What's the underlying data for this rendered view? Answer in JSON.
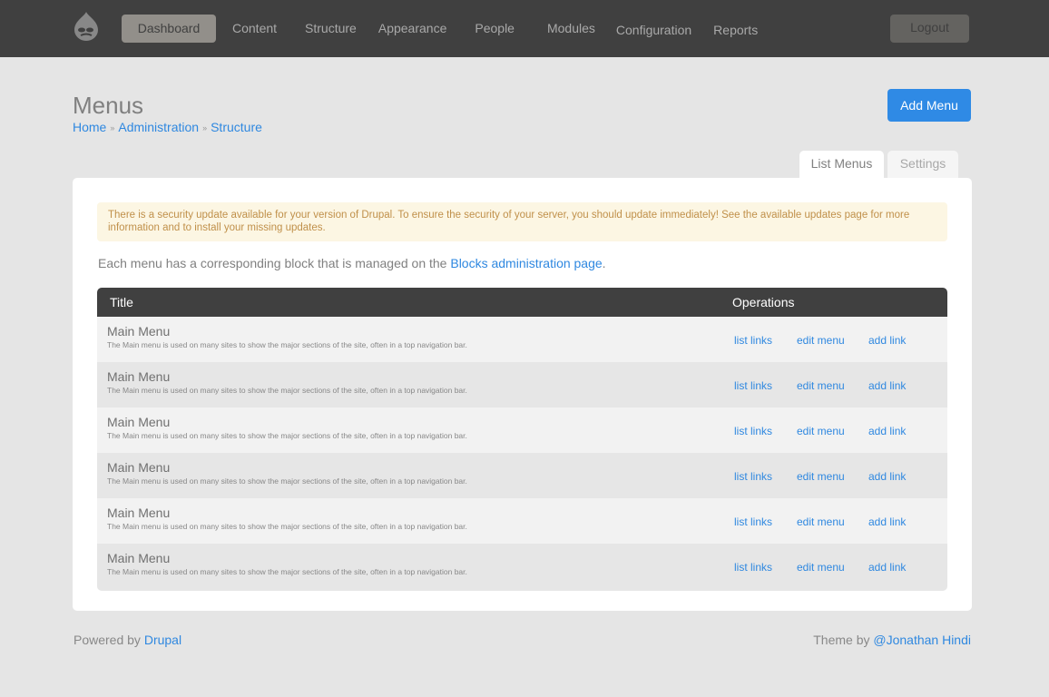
{
  "nav": {
    "items": [
      "Dashboard",
      "Content",
      "Structure",
      "Appearance",
      "People",
      "Modules",
      "Configuration",
      "Reports"
    ],
    "active": "Dashboard",
    "logout": "Logout"
  },
  "page": {
    "title": "Menus",
    "breadcrumb": [
      "Home",
      "Administration",
      "Structure"
    ],
    "add_button": "Add Menu"
  },
  "tabs": [
    "List Menus",
    "Settings"
  ],
  "alert": "There is a security update available for your version of Drupal. To ensure the security of your server, you should update immediately! See the available updates page for more information and to install your missing updates.",
  "intro": {
    "text": "Each menu has a corresponding block that is managed on the ",
    "link": "Blocks administration page",
    "end": "."
  },
  "table": {
    "headers": [
      "Title",
      "Operations"
    ],
    "rows": [
      {
        "title": "Main Menu",
        "desc": "The Main menu is used on many sites to show the major sections of the site, often in a top navigation bar.",
        "ops": [
          "list links",
          "edit menu",
          "add link"
        ]
      },
      {
        "title": "Main Menu",
        "desc": "The Main menu is used on many sites to show the major sections of the site, often in a top navigation bar.",
        "ops": [
          "list links",
          "edit menu",
          "add link"
        ]
      },
      {
        "title": "Main Menu",
        "desc": "The Main menu is used on many sites to show the major sections of the site, often in a top navigation bar.",
        "ops": [
          "list links",
          "edit menu",
          "add link"
        ]
      },
      {
        "title": "Main Menu",
        "desc": "The Main menu is used on many sites to show the major sections of the site, often in a top navigation bar.",
        "ops": [
          "list links",
          "edit menu",
          "add link"
        ]
      },
      {
        "title": "Main Menu",
        "desc": "The Main menu is used on many sites to show the major sections of the site, often in a top navigation bar.",
        "ops": [
          "list links",
          "edit menu",
          "add link"
        ]
      },
      {
        "title": "Main Menu",
        "desc": "The Main menu is used on many sites to show the major sections of the site, often in a top navigation bar.",
        "ops": [
          "list links",
          "edit menu",
          "add link"
        ]
      }
    ]
  },
  "footer": {
    "powered": "Powered by ",
    "drupal": "Drupal",
    "theme": "Theme by ",
    "author": "@Jonathan Hindi"
  },
  "colors": {
    "accent": "#2f8ae5",
    "topbar": "#404040",
    "alert_bg": "#fcf6e3"
  }
}
